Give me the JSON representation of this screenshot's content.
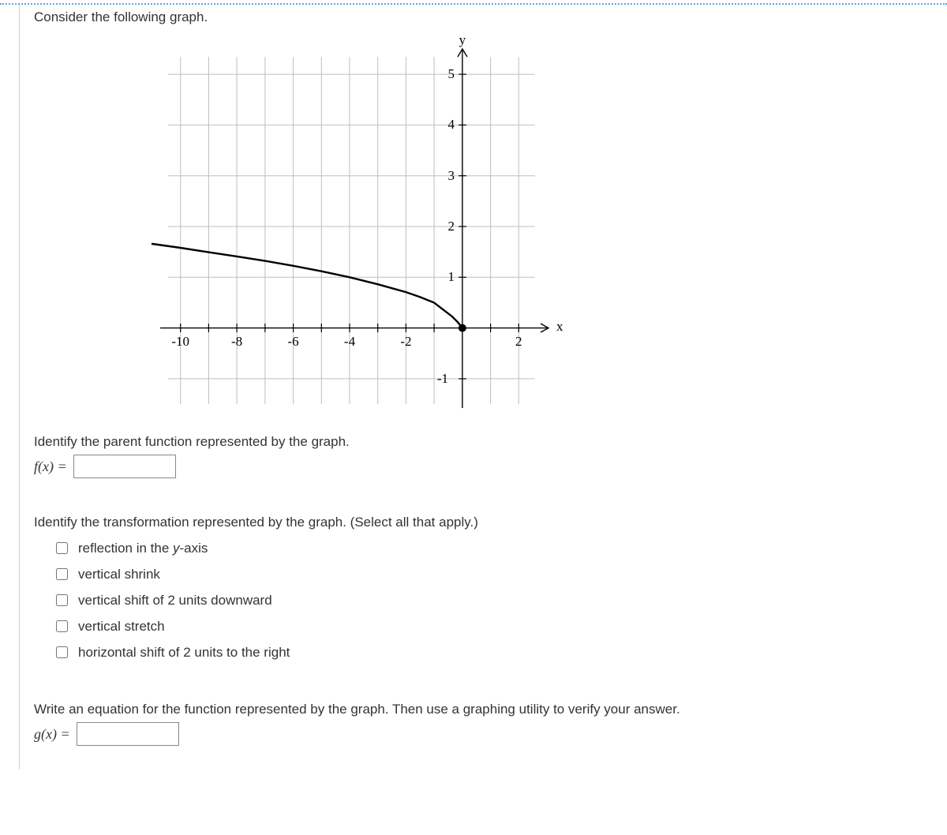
{
  "intro": "Consider the following graph.",
  "q1": {
    "prompt": "Identify the parent function represented by the graph.",
    "lhs": "f(x) ="
  },
  "q2": {
    "prompt": "Identify the transformation represented by the graph. (Select all that apply.)",
    "options": [
      "reflection in the y-axis",
      "vertical shrink",
      "vertical shift of 2 units downward",
      "vertical stretch",
      "horizontal shift of 2 units to the right"
    ]
  },
  "q3": {
    "prompt": "Write an equation for the function represented by the graph. Then use a graphing utility to verify your answer.",
    "lhs": "g(x) ="
  },
  "chart_data": {
    "type": "line",
    "title": "",
    "xlabel": "x",
    "ylabel": "y",
    "xlim": [
      -11,
      3
    ],
    "ylim": [
      -1.5,
      5.5
    ],
    "xticks": [
      -10,
      -8,
      -6,
      -4,
      -2,
      2
    ],
    "yticks": [
      -1,
      1,
      2,
      3,
      4,
      5
    ],
    "series": [
      {
        "name": "curve",
        "points": [
          {
            "x": -11,
            "y": 1.66
          },
          {
            "x": -10,
            "y": 1.58
          },
          {
            "x": -8,
            "y": 1.41
          },
          {
            "x": -6,
            "y": 1.22
          },
          {
            "x": -4,
            "y": 1.0
          },
          {
            "x": -2,
            "y": 0.71
          },
          {
            "x": -1,
            "y": 0.5
          },
          {
            "x": 0,
            "y": 0.0
          }
        ],
        "endpoint": {
          "x": 0,
          "y": 0,
          "filled": true
        }
      }
    ],
    "description": "Curve resembling y = (1/2)·sqrt(-x); reflected square-root with vertical shrink, terminating at a closed dot at the origin."
  }
}
